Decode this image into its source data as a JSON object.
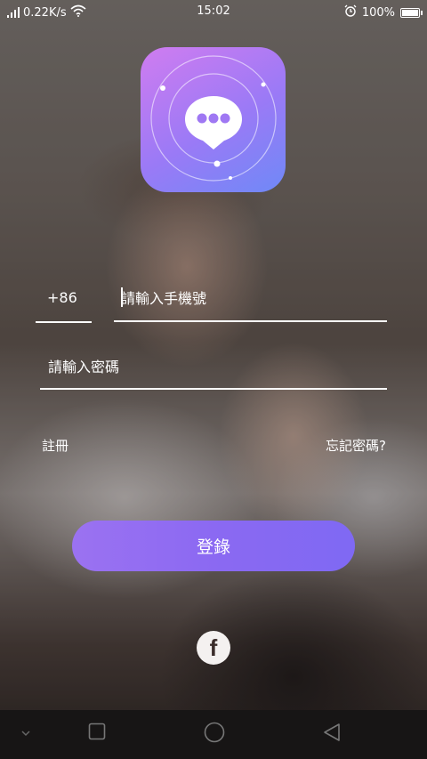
{
  "status_bar": {
    "network_speed": "0.22K/s",
    "time": "15:02",
    "battery": "100%",
    "icons": [
      "signal-icon",
      "wifi-icon",
      "alarm-icon",
      "battery-icon"
    ]
  },
  "app_icon": {
    "icon": "chat-bubble-icon"
  },
  "login": {
    "country_code": "+86",
    "phone_placeholder": "請輸入手機號",
    "password_placeholder": "請輸入密碼",
    "register_label": "註冊",
    "forgot_label": "忘記密碼?",
    "login_label": "登錄"
  },
  "social": {
    "facebook_letter": "f"
  },
  "nav_bar": {
    "icons": [
      "chevron-down-icon",
      "recents-icon",
      "home-icon",
      "back-icon"
    ]
  },
  "colors": {
    "button": "#8b69f2",
    "icon_gradient": [
      "#d07cf0",
      "#9a7af6",
      "#6f89f7"
    ]
  }
}
